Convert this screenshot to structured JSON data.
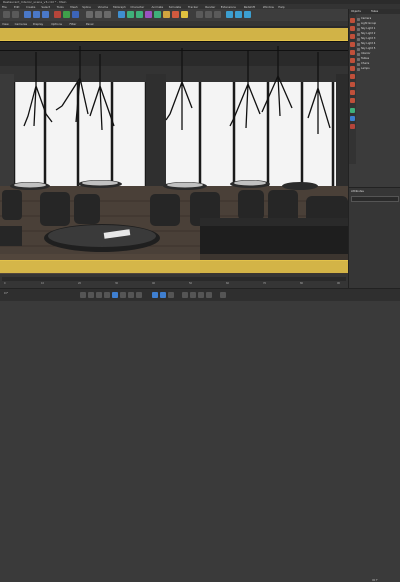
{
  "window": {
    "title": "Restaurant_Interior_scene_v3.c4d * - Main"
  },
  "menu": [
    "File",
    "Edit",
    "Create",
    "Select",
    "Tools",
    "Mesh",
    "Spline",
    "Volume",
    "MoGraph",
    "Character",
    "Animate",
    "Simulate",
    "Tracker",
    "Render",
    "Extensions",
    "Redshift",
    "Window",
    "Help"
  ],
  "view_menu": [
    "View",
    "Cameras",
    "Display",
    "Options",
    "Filter",
    "Panel"
  ],
  "object_manager": {
    "tabs": [
      "Objects",
      "Takes"
    ],
    "menu_label": "File Edit View",
    "objects": [
      "Camera",
      "Light Group",
      "Sky Light 1",
      "Sky Light 2",
      "Sky Light 3",
      "Sky Light 4",
      "Sky Light 5",
      "Interior",
      "Tables",
      "Chairs",
      "Lamps"
    ]
  },
  "attributes": {
    "title": "Attributes",
    "mode_label": "Mode Edit User Data"
  },
  "timeline": {
    "ticks": [
      "0",
      "10",
      "20",
      "30",
      "40",
      "50",
      "60",
      "70",
      "80",
      "90"
    ],
    "current_frame": "0 F"
  },
  "status": {
    "end_frame": "90 F"
  },
  "colors": {
    "accent": "#e3c24a",
    "ui_bg": "#3a3a3a",
    "play_blue": "#3f7fd0"
  }
}
